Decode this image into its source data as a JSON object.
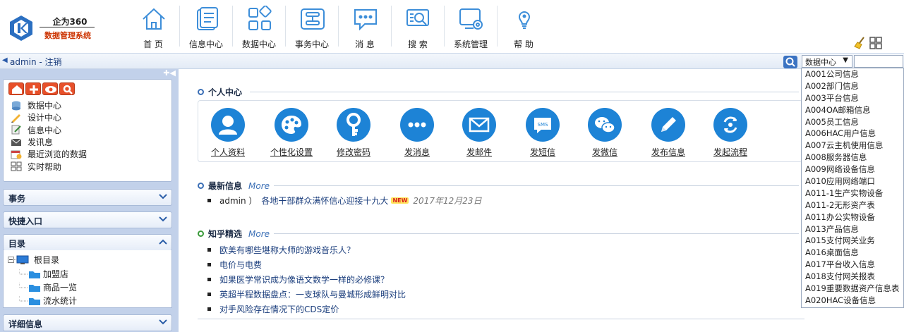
{
  "logo": {
    "title": "企为360",
    "subtitle": "数据管理系统"
  },
  "nav": [
    {
      "label": "首 页",
      "icon": "home-icon"
    },
    {
      "label": "信息中心",
      "icon": "document-icon"
    },
    {
      "label": "数据中心",
      "icon": "grid-icon"
    },
    {
      "label": "事务中心",
      "icon": "workflow-icon"
    },
    {
      "label": "消 息",
      "icon": "message-icon"
    },
    {
      "label": "搜 索",
      "icon": "search-icon"
    },
    {
      "label": "系统管理",
      "icon": "settings-icon"
    },
    {
      "label": "帮 助",
      "icon": "help-icon"
    }
  ],
  "userbar": {
    "user_text": "admin - 注销"
  },
  "search": {
    "select_value": "数据中心"
  },
  "sidebar": {
    "menu": [
      {
        "label": "数据中心",
        "icon": "database-icon"
      },
      {
        "label": "设计中心",
        "icon": "design-icon"
      },
      {
        "label": "信息中心",
        "icon": "edit-icon"
      },
      {
        "label": "发讯息",
        "icon": "mail-icon"
      },
      {
        "label": "最近浏览的数据",
        "icon": "calendar-icon"
      },
      {
        "label": "实时帮助",
        "icon": "help-grid-icon"
      }
    ],
    "sections": {
      "affairs": "事务",
      "shortcuts": "快捷入口",
      "catalog": "目录",
      "details": "详细信息"
    },
    "tree": {
      "root": "根目录",
      "children": [
        "加盟店",
        "商品一览",
        "流水统计"
      ]
    }
  },
  "main": {
    "personal": {
      "title": "个人中心",
      "items": [
        {
          "label": "个人资料",
          "icon": "user-icon"
        },
        {
          "label": "个性化设置",
          "icon": "palette-icon"
        },
        {
          "label": "修改密码",
          "icon": "key-icon"
        },
        {
          "label": "发消息",
          "icon": "dots-icon"
        },
        {
          "label": "发邮件",
          "icon": "envelope-icon"
        },
        {
          "label": "发短信",
          "icon": "sms-icon"
        },
        {
          "label": "发微信",
          "icon": "wechat-icon"
        },
        {
          "label": "发布信息",
          "icon": "pencil-icon"
        },
        {
          "label": "发起流程",
          "icon": "process-icon"
        }
      ]
    },
    "news": {
      "title": "最新信息",
      "more": "More",
      "item": {
        "author": "admin ）",
        "title": "各地干部群众满怀信心迎接十九大",
        "badge": "NEW",
        "date": "2017年12月23日"
      }
    },
    "zhihu": {
      "title": "知乎精选",
      "more": "More",
      "items": [
        "欧美有哪些堪称大师的游戏音乐人？",
        "电价与电费",
        "如果医学常识成为像语文数学一样的必修课？",
        "英超半程数据盘点：一支球队与曼城形成鲜明对比",
        "对手风险存在情况下的CDS定价"
      ]
    }
  },
  "dropdown": [
    "A001公司信息",
    "A002部门信息",
    "A003平台信息",
    "A004OA邮箱信息",
    "A005员工信息",
    "A006HAC用户信息",
    "A007云主机使用信息",
    "A008服务器信息",
    "A009网络设备信息",
    "A010应用网络端口",
    "A011-1生产实物设备",
    "A011-2无形资产表",
    "A011办公实物设备",
    "A013产品信息",
    "A015支付网关业务",
    "A016桌面信息",
    "A017平台收入信息",
    "A018支付网关报表",
    "A019重要数据资产信息表",
    "A020HAC设备信息"
  ]
}
